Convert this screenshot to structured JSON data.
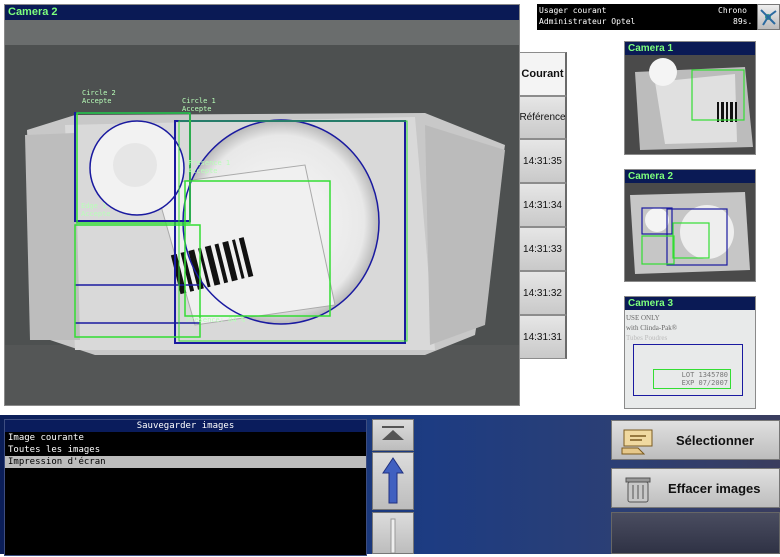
{
  "main_camera": {
    "title": "Camera 2",
    "labels": {
      "circle2": "Circle 2\nAccepte",
      "circle1": "Circle 1\nAccepte",
      "presence1": "Presence 1\nAccepte",
      "edge1": "Edge 1\nAccepte",
      "presence_pct": "Presence: 84 %"
    }
  },
  "status": {
    "row1_label": "Usager courant",
    "row1_right": "Chrono",
    "row2_label": "Administrateur Optel",
    "row2_right": "89s."
  },
  "time_tabs": [
    "Courant",
    "Référence",
    "14:31:35",
    "14:31:34",
    "14:31:33",
    "14:31:32",
    "14:31:31"
  ],
  "thumbnails": [
    {
      "title": "Camera 1"
    },
    {
      "title": "Camera 2"
    },
    {
      "title": "Camera 3",
      "text_lines": [
        "USE ONLY",
        "with Clinda-Pak®",
        "Tubes Poudres"
      ],
      "lot_line1": "LOT  1345780",
      "lot_line2": "EXP  07/2007"
    }
  ],
  "save_panel": {
    "header": "Sauvegarder images",
    "items": [
      "Image courante",
      "Toutes les images",
      "Impression d'écran"
    ],
    "selected_index": 2
  },
  "actions": {
    "select_label": "Sélectionner",
    "delete_label": "Effacer images"
  },
  "colors": {
    "overlay_green": "#33dd33",
    "overlay_blue": "#1a1aa0",
    "title_bar": "#0a1a55",
    "title_text": "#7dff7d"
  }
}
